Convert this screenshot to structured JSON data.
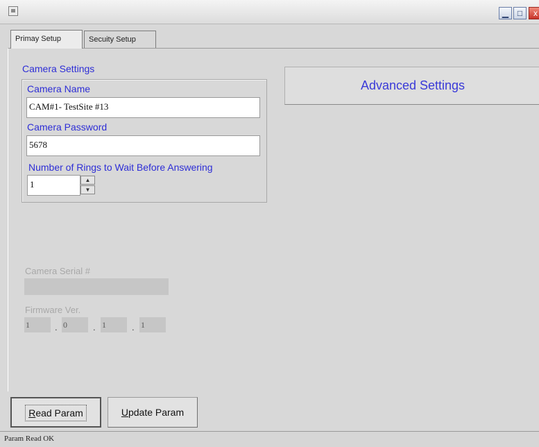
{
  "window": {
    "min_glyph": "▁",
    "max_glyph": "□",
    "close_glyph": "x"
  },
  "tabs": [
    {
      "label": "Primay Setup",
      "active": true
    },
    {
      "label": "Secuity Setup",
      "active": false
    }
  ],
  "camera_settings": {
    "group_label": "Camera Settings",
    "name_label": "Camera Name",
    "name_value": "CAM#1- TestSite #13",
    "password_label": "Camera Password",
    "password_value": "5678",
    "rings_label": "Number of Rings to Wait Before Answering",
    "rings_value": "1"
  },
  "advanced_button_label": "Advanced Settings",
  "serial": {
    "label": "Camera Serial #",
    "value": ""
  },
  "firmware": {
    "label": "Firmware Ver.",
    "parts": [
      "1",
      "0",
      "1",
      "1"
    ],
    "separator": "."
  },
  "buttons": {
    "read_mnemonic": "R",
    "read_rest": "ead Param",
    "update_mnemonic": "U",
    "update_rest": "pdate Param"
  },
  "status_text": "Param Read OK",
  "colors": {
    "label_blue": "#2e2ed6",
    "window_bg": "#d8d8d8"
  }
}
